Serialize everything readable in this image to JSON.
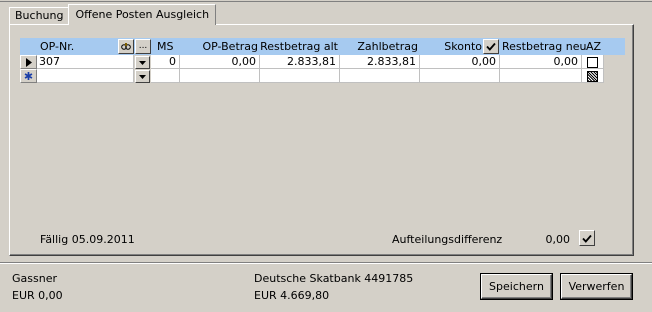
{
  "tabs": [
    {
      "label": "Buchung",
      "active": false
    },
    {
      "label": "Offene Posten Ausgleich",
      "active": true
    }
  ],
  "grid": {
    "columns": {
      "op_nr": "OP-Nr.",
      "ms": "MS",
      "op_betrag": "OP-Betrag",
      "restbetrag_alt": "Restbetrag alt",
      "zahlbetrag": "Zahlbetrag",
      "skonto": "Skonto",
      "restbetrag_neu": "Restbetrag neu",
      "az": "AZ"
    },
    "header_more_button": "...",
    "rows": [
      {
        "op_nr": "307",
        "ms": "0",
        "op_betrag": "0,00",
        "restbetrag_alt": "2.833,81",
        "zahlbetrag": "2.833,81",
        "skonto": "0,00",
        "restbetrag_neu": "0,00"
      }
    ],
    "new_row_marker": "✱"
  },
  "footer_panel": {
    "faellig": "Fällig 05.09.2011",
    "aufteilungsdifferenz_label": "Aufteilungsdifferenz",
    "aufteilungsdifferenz_value": "0,00"
  },
  "status": {
    "customer_name": "Gassner",
    "customer_balance": "EUR 0,00",
    "bank_name": "Deutsche Skatbank 4491785",
    "bank_balance": "EUR 4.669,80"
  },
  "buttons": {
    "save_label": "Speichern",
    "discard_label": "Verwerfen"
  },
  "colors": {
    "window_bg": "#d4d0c8",
    "header_bg": "#a6caf0"
  }
}
